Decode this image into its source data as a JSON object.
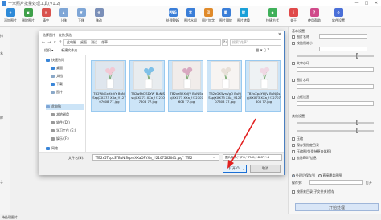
{
  "app": {
    "title": "一米照片批量处理工具(V1.2)",
    "window_buttons": [
      "—",
      "□",
      "✕"
    ]
  },
  "toolbar": {
    "buttons": [
      {
        "label": "添加图片",
        "color": "#2e8ad8",
        "glyph": "+"
      },
      {
        "label": "删除图片",
        "color": "#3fa04a",
        "glyph": "▣"
      },
      {
        "label": "清空",
        "color": "#d9534f",
        "glyph": "✕"
      },
      {
        "label": "上移",
        "color": "#7fa6d6",
        "glyph": "▲"
      },
      {
        "label": "下移",
        "color": "#7fa6d6",
        "glyph": "▼"
      },
      {
        "label": "移动",
        "color": "#7a8fb8",
        "glyph": "✥"
      },
      {
        "label": "处理PNG",
        "color": "#3a7ed8",
        "glyph": "PNG"
      },
      {
        "label": "图片水印",
        "color": "#3a7ed8",
        "glyph": "字"
      },
      {
        "label": "图片加字",
        "color": "#e08a2a",
        "glyph": "印"
      },
      {
        "label": "图片翻转",
        "color": "#3a7ed8",
        "glyph": "翻"
      },
      {
        "label": "图片转换",
        "color": "#1aa0d8",
        "glyph": "转"
      },
      {
        "label": "快捷方式",
        "color": "#3fb05a",
        "glyph": "◆"
      },
      {
        "label": "关于",
        "color": "#e04a4a",
        "glyph": "i"
      },
      {
        "label": "使用帮助",
        "color": "#d04a8a",
        "glyph": "?"
      },
      {
        "label": "软件设置",
        "color": "#4a6fd8",
        "glyph": "⚙"
      }
    ]
  },
  "left_strip": [
    "排",
    "名",
    "称",
    "字"
  ],
  "dialog": {
    "title": "选择图片 - 支持多选",
    "close": "✕",
    "nav": [
      "←",
      "→",
      "∨",
      "↑"
    ],
    "breadcrumb": [
      "此电脑",
      "桌面",
      "测试",
      "花草"
    ],
    "refresh": "↻",
    "search_placeholder": "搜索\"花草\"",
    "commands": [
      "组织 ▾",
      "新建文件夹"
    ],
    "view_icons": "▦ ▾  ▯  ?",
    "sidebar": [
      {
        "label": "快速访问",
        "color": "#3a86d8"
      },
      {
        "label": "桌面",
        "color": "#3a86d8"
      },
      {
        "label": "文档",
        "color": "#8aa8c8"
      },
      {
        "label": "下载",
        "color": "#3a86d8"
      },
      {
        "label": "图片",
        "color": "#8aa8c8"
      },
      {
        "label": "此电脑",
        "color": "#7fa6d6"
      },
      {
        "label": "本地磁盘",
        "color": "#999999"
      },
      {
        "label": "软件 (D:)",
        "color": "#999999"
      },
      {
        "label": "学习工作 (E:)",
        "color": "#999999"
      },
      {
        "label": "娱乐 (F:)",
        "color": "#999999"
      },
      {
        "label": "网络",
        "color": "#3a86d8"
      }
    ],
    "sidebar_selected": 5,
    "files": [
      {
        "name": "TB2WbGxXkIVY BuNjSspjXXX73 XXa_!!12707608 77.jpg",
        "bg": "#dfe6ee",
        "flower": "#f2c8d4"
      },
      {
        "name": "TB2wEhDSDYW BuNjSspjXXX73 XXa_!!12707608 77.jpg",
        "bg": "#e8ecef",
        "flower": "#7ec0e8"
      },
      {
        "name": "TB2xeB2XkIJV BuNjSspjXXX73 XXa_!!12707608 77.jpg",
        "bg": "#f1ecea",
        "flower": "#d8a8c0"
      },
      {
        "name": "TB2xGX5vnVgO BuNjSspjXXX73 XXa_!!12707608 77.jpg",
        "bg": "#f7f4f2",
        "flower": "#e8e0d8"
      },
      {
        "name": "TB2xXpaYkIJV BuNjSspjXXX73 XXa_!!12707608 77.jpg",
        "bg": "#eef2f4",
        "flower": "#f0d8e4"
      }
    ],
    "filename_label": "文件名(N):",
    "filename_value": "\"TB2x5TkpLSTBuNjSspmXXaORYXa_!!2107562041.jpg\" \"TB2",
    "filetype_value": "图片文件(*.JPG;*.PNG;*.BMP;*.G",
    "open_label": "打开(O)",
    "open_split": "▾",
    "cancel_label": "取消"
  },
  "right_panel": {
    "section1": "基本设置",
    "opt_rename": "图片名称",
    "opt_resize": "按比例缩小",
    "opt_width": "宽度",
    "opt_text": "文字水印",
    "opt_image": "图片水印",
    "opt_border": "边框设置",
    "section2": "其他设置",
    "opt_quality": "压缩",
    "opt_folder": "保存到指定目录",
    "opt_compress": "压缩图片(保持原来体积)",
    "opt_exif": "去除EXIF信息",
    "radio_output": "处理后保存到",
    "radio_overwrite": "直接覆盖原图",
    "save_label": "保存到:",
    "open_folder": "打开",
    "keep_dir": "按原来目录(子文件夹)保存",
    "start_button": "开始处理"
  },
  "statusbar": "待处理图片:"
}
